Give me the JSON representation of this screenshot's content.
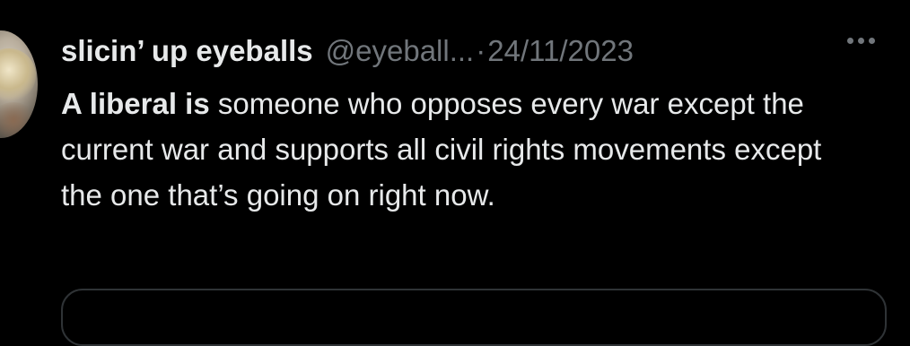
{
  "tweet": {
    "display_name": "slicin’ up eyeballs",
    "handle": "@eyeball...",
    "separator": "·",
    "date": "24/11/2023",
    "more_icon": "more-horizontal-icon",
    "text_bold": "A liberal is",
    "text_rest": " someone who opposes every war except the current war and supports all civil rights movements except the one that’s going on right now."
  },
  "colors": {
    "background": "#000000",
    "primary_text": "#e7e9ea",
    "secondary_text": "#71767b",
    "border": "#2f3336"
  }
}
